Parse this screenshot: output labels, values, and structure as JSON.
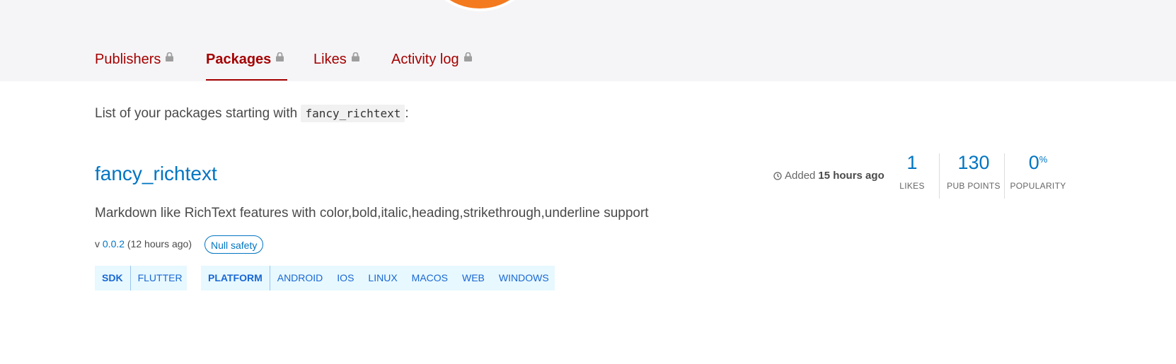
{
  "tabs": [
    {
      "label": "Publishers",
      "locked": true
    },
    {
      "label": "Packages",
      "locked": true,
      "active": true
    },
    {
      "label": "Likes",
      "locked": true
    },
    {
      "label": "Activity log",
      "locked": true
    }
  ],
  "intro": {
    "text": "List of your packages starting with",
    "query": "fancy_richtext",
    "suffix": ":"
  },
  "package": {
    "name": "fancy_richtext",
    "added_prefix": "Added",
    "added_time": "15 hours ago",
    "description": "Markdown like RichText features with color,bold,italic,heading,strikethrough,underline support",
    "version_prefix": "v",
    "version": "0.0.2",
    "version_age": "(12 hours ago)",
    "badge": "Null safety",
    "metrics": {
      "likes": {
        "value": "1",
        "label": "LIKES"
      },
      "points": {
        "value": "130",
        "label": "PUB POINTS"
      },
      "popularity": {
        "value": "0",
        "unit": "%",
        "label": "POPULARITY"
      }
    },
    "sdk": {
      "label": "SDK",
      "items": [
        "FLUTTER"
      ]
    },
    "platform": {
      "label": "PLATFORM",
      "items": [
        "ANDROID",
        "IOS",
        "LINUX",
        "MACOS",
        "WEB",
        "WINDOWS"
      ]
    }
  },
  "colors": {
    "tab_text": "#a40000",
    "link": "#0175c2",
    "tag_bg": "#e7f8ff",
    "tag_text": "#1967d2",
    "avatar": "#f47a1f"
  },
  "icons": {
    "lock": "lock-icon",
    "clock": "clock-icon"
  }
}
